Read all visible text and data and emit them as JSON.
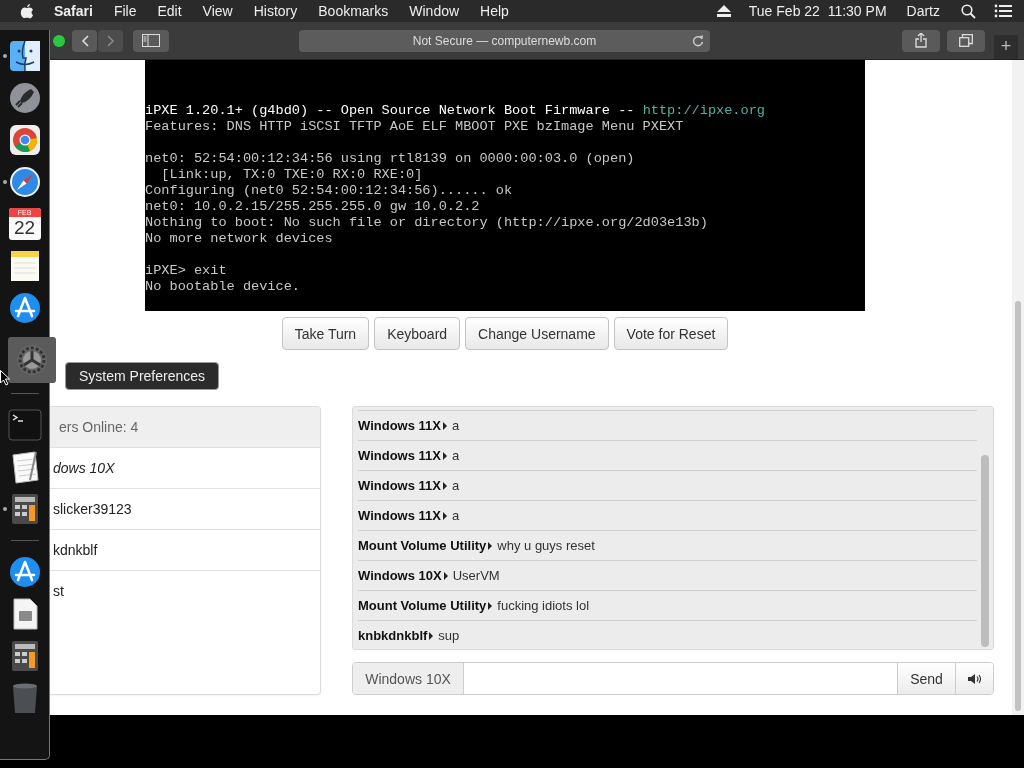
{
  "menu_bar": {
    "app": "Safari",
    "items": [
      "File",
      "Edit",
      "View",
      "History",
      "Bookmarks",
      "Window",
      "Help"
    ],
    "clock": "Tue Feb 22  11:30 PM",
    "user": "Dartz"
  },
  "toolbar": {
    "address": "Not Secure — computernewb.com",
    "new_tab": "+"
  },
  "dock": [
    {
      "kind": "finder",
      "running": true
    },
    {
      "kind": "rocket",
      "running": false
    },
    {
      "kind": "browser",
      "running": false
    },
    {
      "kind": "compass",
      "running": true
    },
    {
      "kind": "calendar",
      "running": false,
      "month": "FEB",
      "day": "22"
    },
    {
      "kind": "notes",
      "running": false
    },
    {
      "kind": "appstore",
      "running": false
    },
    {
      "kind": "settings",
      "running": false,
      "highlighted": true
    },
    {
      "kind": "separator"
    },
    {
      "kind": "terminal",
      "running": false
    },
    {
      "kind": "textedit",
      "running": false
    },
    {
      "kind": "calculator",
      "running": true
    },
    {
      "kind": "separator"
    },
    {
      "kind": "appstore",
      "running": false
    },
    {
      "kind": "document",
      "running": false
    },
    {
      "kind": "calculator",
      "running": false
    },
    {
      "kind": "trash",
      "running": false
    }
  ],
  "tooltip": "System Preferences",
  "terminal": {
    "blocks": [
      {
        "lines": [
          {
            "text": "iPXE 1.20.1+ (g4bd0) -- Open Source Network Boot Firmware -- ",
            "link": "http://ipxe.org",
            "bright": true
          },
          {
            "text": "Features: DNS HTTP iSCSI TFTP AoE ELF MBOOT PXE bzImage Menu PXEXT",
            "bright": false
          }
        ]
      },
      {
        "lines": [
          {
            "text": "net0: 52:54:00:12:34:56 using rtl8139 on 0000:00:03.0 (open)",
            "bright": false
          },
          {
            "text": "  [Link:up, TX:0 TXE:0 RX:0 RXE:0]",
            "bright": false
          },
          {
            "text": "Configuring (net0 52:54:00:12:34:56)...... ok",
            "bright": false
          },
          {
            "text": "net0: 10.0.2.15/255.255.255.0 gw 10.0.2.2",
            "bright": false
          },
          {
            "text": "Nothing to boot: No such file or directory (http://ipxe.org/2d03e13b)",
            "bright": false
          },
          {
            "text": "No more network devices",
            "bright": false
          }
        ]
      },
      {
        "lines": [
          {
            "text": "iPXE> exit",
            "bright": false
          },
          {
            "text": "No bootable device.",
            "bright": false
          }
        ]
      }
    ]
  },
  "buttons": [
    "Take Turn",
    "Keyboard",
    "Change Username",
    "Vote for Reset"
  ],
  "users": {
    "header": "ers Online: 4",
    "items": [
      {
        "name": "dows 10X",
        "current": true
      },
      {
        "name": "slicker39123",
        "current": false
      },
      {
        "name": "kdnkblf",
        "current": false
      },
      {
        "name": "st",
        "current": false
      }
    ]
  },
  "chat": {
    "messages": [
      {
        "user": "Windows 11X",
        "text": "a"
      },
      {
        "user": "Windows 11X",
        "text": "a"
      },
      {
        "user": "Windows 11X",
        "text": "a"
      },
      {
        "user": "Windows 11X",
        "text": "a"
      },
      {
        "user": "Mount Volume Utility",
        "text": "why u guys reset"
      },
      {
        "user": "Windows 10X",
        "text": "UserVM"
      },
      {
        "user": "Mount Volume Utility",
        "text": "fucking idiots lol"
      },
      {
        "user": "knbkdnkblf",
        "text": "sup"
      }
    ],
    "username": "Windows 10X",
    "send": "Send"
  }
}
